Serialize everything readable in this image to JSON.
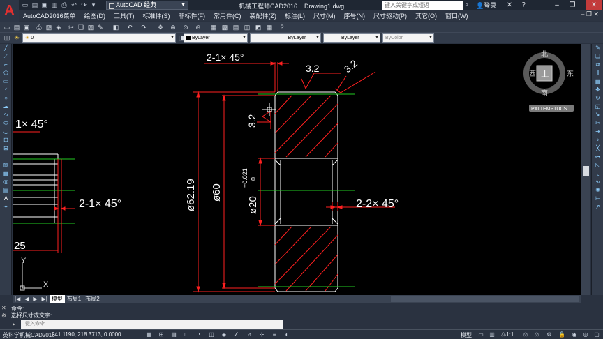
{
  "app": {
    "workspace": "AutoCAD 经典",
    "title": "机械工程师CAD2016",
    "file": "Drawing1.dwg",
    "search_placeholder": "键入关键字或短语",
    "login": "登录"
  },
  "menus": [
    "AutoCAD2016菜单",
    "绘图(D)",
    "工具(T)",
    "标准件(S)",
    "非标件(F)",
    "常用件(C)",
    "装配件(Z)",
    "标注(L)",
    "尺寸(M)",
    "序号(N)",
    "尺寸驱动(P)",
    "其它(O)",
    "窗口(W)"
  ],
  "properties": {
    "layer": "0",
    "color": "ByLayer",
    "linetype": "ByLayer",
    "lineweight": "ByLayer",
    "plotstyle": "ByColor"
  },
  "viewcube": {
    "north": "北",
    "south": "南",
    "east": "东",
    "west": "西",
    "top": "上",
    "ucs": "PXLTEMPTUCS"
  },
  "drawing": {
    "chamfer_top": "2-1× 45°",
    "chamfer_left": "1× 45°",
    "chamfer_mid": "2-1× 45°",
    "chamfer_right": "2-2× 45°",
    "rough_1": "3.2",
    "rough_2": "3.2",
    "rough_3": "3.2",
    "dia_outer": "ø62.19",
    "dia_60": "ø60",
    "dia_bore": "ø20",
    "tol_upper": "+0.021",
    "tol_lower": "0",
    "dim_25": "25",
    "axis_y": "Y",
    "axis_x": "X"
  },
  "tabs": [
    "模型",
    "布局1",
    "布局2"
  ],
  "command": {
    "line1": "命令:",
    "line2": "选择尺寸或文字:",
    "placeholder": "键入命令"
  },
  "status": {
    "app_name": "英科学机械CAD2016",
    "coords": "241.1190, 218.3713, 0.0000",
    "model": "模型",
    "scale": "1:1"
  }
}
